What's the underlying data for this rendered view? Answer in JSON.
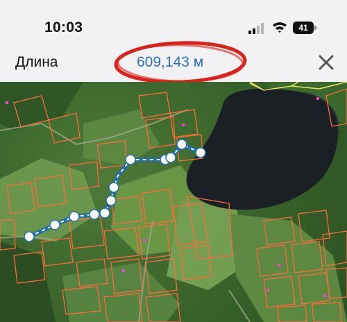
{
  "status_bar": {
    "time": "10:03",
    "battery_level": "41",
    "icons": [
      "signal-icon",
      "wifi-icon",
      "battery-icon"
    ]
  },
  "measure": {
    "title": "Длина",
    "value": "609,143 м",
    "close_icon": "close-icon",
    "accent_color": "#2a73b8",
    "highlight_color": "#d8231b"
  },
  "map": {
    "type": "satellite",
    "route_color": "#1f6fae",
    "parcel_color": "#ff6a3d",
    "lake_color": "#1b2024",
    "waypoint_count": 12
  }
}
